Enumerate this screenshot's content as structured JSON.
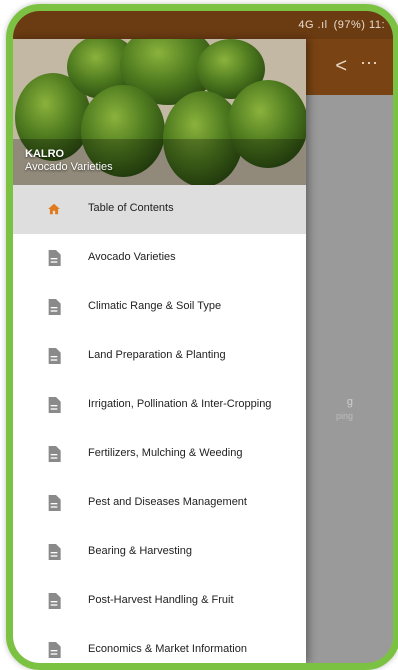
{
  "status_bar": {
    "signal": "4G .ıl",
    "battery_time": "(97%) 11:"
  },
  "drawer": {
    "header": {
      "title": "KALRO",
      "subtitle": "Avocado Varieties"
    },
    "items": [
      {
        "label": "Table of Contents",
        "icon": "home-icon"
      },
      {
        "label": "Avocado Varieties",
        "icon": "document-icon"
      },
      {
        "label": "Climatic Range & Soil Type",
        "icon": "document-icon"
      },
      {
        "label": "Land Preparation & Planting",
        "icon": "document-icon"
      },
      {
        "label": "Irrigation, Pollination & Inter-Cropping",
        "icon": "document-icon"
      },
      {
        "label": "Fertilizers, Mulching & Weeding",
        "icon": "document-icon"
      },
      {
        "label": "Pest and Diseases Management",
        "icon": "document-icon"
      },
      {
        "label": "Bearing & Harvesting",
        "icon": "document-icon"
      },
      {
        "label": "Post-Harvest Handling & Fruit",
        "icon": "document-icon"
      },
      {
        "label": "Economics & Market Information",
        "icon": "document-icon"
      }
    ]
  },
  "background": {
    "partial_text": "g",
    "partial_sub": "ping"
  },
  "colors": {
    "frame": "#7cc242",
    "appbar": "#7a4313",
    "home_icon": "#e07a1f",
    "doc_icon": "#8a8a8a"
  }
}
